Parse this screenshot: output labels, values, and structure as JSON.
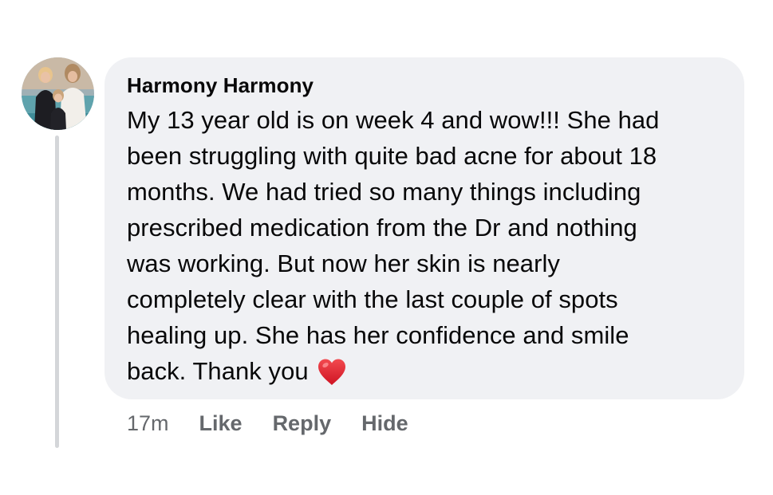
{
  "comment": {
    "author": "Harmony Harmony",
    "lines": [
      "My 13 year old is on week 4 and wow!!! She had",
      "been struggling with quite bad acne for about 18",
      "months. We had tried so many things including",
      "prescribed medication from the Dr and nothing",
      "was working. But now her skin is nearly",
      "completely clear with the last couple of spots",
      "healing up. She has her confidence and smile",
      "back. Thank you"
    ],
    "emoji": "heart-icon",
    "timestamp": "17m",
    "actions": {
      "like": "Like",
      "reply": "Reply",
      "hide": "Hide"
    }
  },
  "colors": {
    "bubble_background": "#f0f1f4",
    "text": "#080809",
    "meta_text": "#65686c",
    "thread_line": "#d4d6d9",
    "heart": "#e0202e"
  }
}
